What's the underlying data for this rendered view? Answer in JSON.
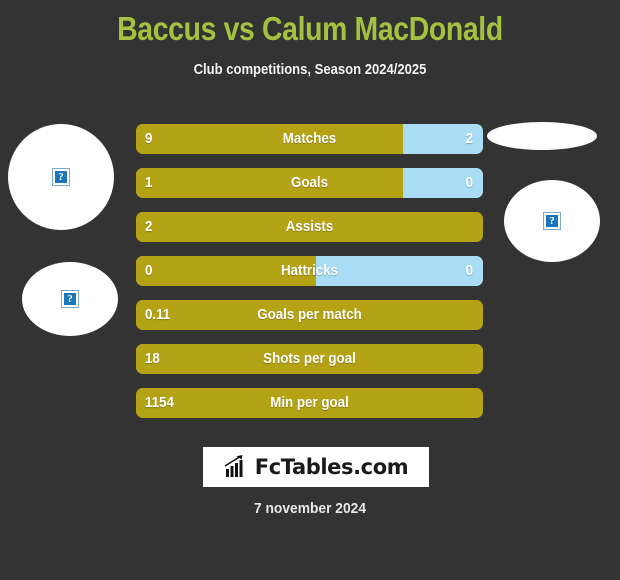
{
  "header": {
    "title": "Baccus vs Calum MacDonald",
    "subtitle": "Club competitions, Season 2024/2025",
    "title_color": "#a4c13f"
  },
  "colors": {
    "background": "#333333",
    "bar_home": "#b5a316",
    "bar_away": "#a8ddf5",
    "text": "#ffffff"
  },
  "avatars": {
    "placeholder_glyph": "?",
    "left": [
      {
        "name": "home-player-photo"
      },
      {
        "name": "home-club-badge"
      }
    ],
    "right": [
      {
        "name": "away-club-badge"
      },
      {
        "name": "away-player-photo"
      }
    ]
  },
  "stats": [
    {
      "label": "Matches",
      "home": "9",
      "away": "2",
      "home_pct": 77,
      "split": true
    },
    {
      "label": "Goals",
      "home": "1",
      "away": "0",
      "home_pct": 77,
      "split": true
    },
    {
      "label": "Assists",
      "home": "2",
      "away": "",
      "home_pct": 100,
      "split": false
    },
    {
      "label": "Hattricks",
      "home": "0",
      "away": "0",
      "home_pct": 52,
      "split": true
    },
    {
      "label": "Goals per match",
      "home": "0.11",
      "away": "",
      "home_pct": 100,
      "split": false
    },
    {
      "label": "Shots per goal",
      "home": "18",
      "away": "",
      "home_pct": 100,
      "split": false
    },
    {
      "label": "Min per goal",
      "home": "1154",
      "away": "",
      "home_pct": 100,
      "split": false
    }
  ],
  "footer": {
    "logo_text": "FcTables.com",
    "logo_icon": "bar-chart-icon",
    "date": "7 november 2024"
  }
}
